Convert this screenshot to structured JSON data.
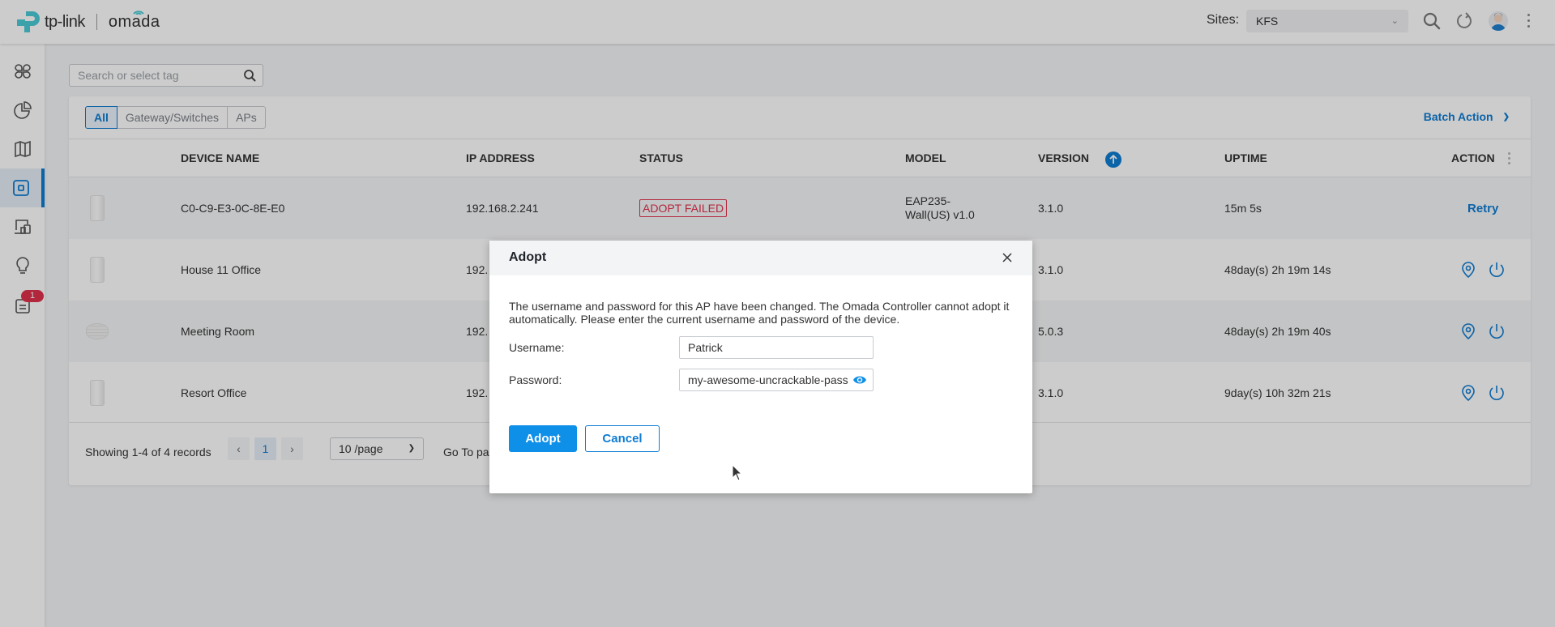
{
  "header": {
    "brand": "tp-link",
    "product": "omada",
    "sites_label": "Sites:",
    "site_selected": "KFS",
    "icons": [
      "search-icon",
      "refresh-icon",
      "user-avatar",
      "more-vertical-icon"
    ]
  },
  "sidebar": {
    "items": [
      {
        "name": "dashboard",
        "icon": "dashboard-icon",
        "active": false
      },
      {
        "name": "statistics",
        "icon": "pie-chart-icon",
        "active": false
      },
      {
        "name": "map",
        "icon": "map-icon",
        "active": false
      },
      {
        "name": "devices",
        "icon": "device-icon",
        "active": true
      },
      {
        "name": "clients",
        "icon": "clients-icon",
        "active": false
      },
      {
        "name": "insights",
        "icon": "lightbulb-icon",
        "active": false
      },
      {
        "name": "logs",
        "icon": "logs-icon",
        "active": false,
        "badge": "1"
      }
    ]
  },
  "search": {
    "placeholder": "Search or select tag",
    "value": ""
  },
  "filters": {
    "tabs": [
      {
        "label": "All",
        "active": true
      },
      {
        "label": "Gateway/Switches",
        "active": false
      },
      {
        "label": "APs",
        "active": false
      }
    ],
    "batch_action": "Batch Action"
  },
  "table": {
    "columns": [
      "DEVICE NAME",
      "IP ADDRESS",
      "STATUS",
      "MODEL",
      "VERSION",
      "UPTIME",
      "ACTION"
    ],
    "rows": [
      {
        "device_type": "wall",
        "name": "C0-C9-E3-0C-8E-E0",
        "ip": "192.168.2.241",
        "status": "ADOPT FAILED",
        "model_line1": "EAP235-",
        "model_line2": "Wall(US) v1.0",
        "version": "3.1.0",
        "uptime": "15m 5s",
        "action": "Retry"
      },
      {
        "device_type": "wall",
        "name": "House 11 Office",
        "ip": "192.",
        "status": "",
        "model_line1": "",
        "model_line2": "",
        "version": "3.1.0",
        "uptime": "48day(s) 2h 19m 14s",
        "action": ""
      },
      {
        "device_type": "ceiling",
        "name": "Meeting Room",
        "ip": "192.",
        "status": "",
        "model_line1": "",
        "model_line2": "",
        "version": "5.0.3",
        "uptime": "48day(s) 2h 19m 40s",
        "action": ""
      },
      {
        "device_type": "wall",
        "name": "Resort Office",
        "ip": "192.",
        "status": "",
        "model_line1": "",
        "model_line2": "",
        "version": "3.1.0",
        "uptime": "9day(s) 10h 32m 21s",
        "action": ""
      }
    ]
  },
  "pagination": {
    "summary": "Showing 1-4 of 4 records",
    "current_page": "1",
    "page_size": "10 /page",
    "goto_label": "Go To pa"
  },
  "modal": {
    "title": "Adopt",
    "message": "The username and password for this AP have been changed. The Omada Controller cannot adopt it automatically. Please enter the current username and password of the device.",
    "username_label": "Username:",
    "username_value": "Patrick",
    "password_label": "Password:",
    "password_value": "my-awesome-uncrackable-pass",
    "adopt_button": "Adopt",
    "cancel_button": "Cancel"
  },
  "colors": {
    "accent": "#0e7cd3",
    "primary_button": "#0e8fe8",
    "error": "#e0314c",
    "logo_teal": "#4acbd6"
  }
}
